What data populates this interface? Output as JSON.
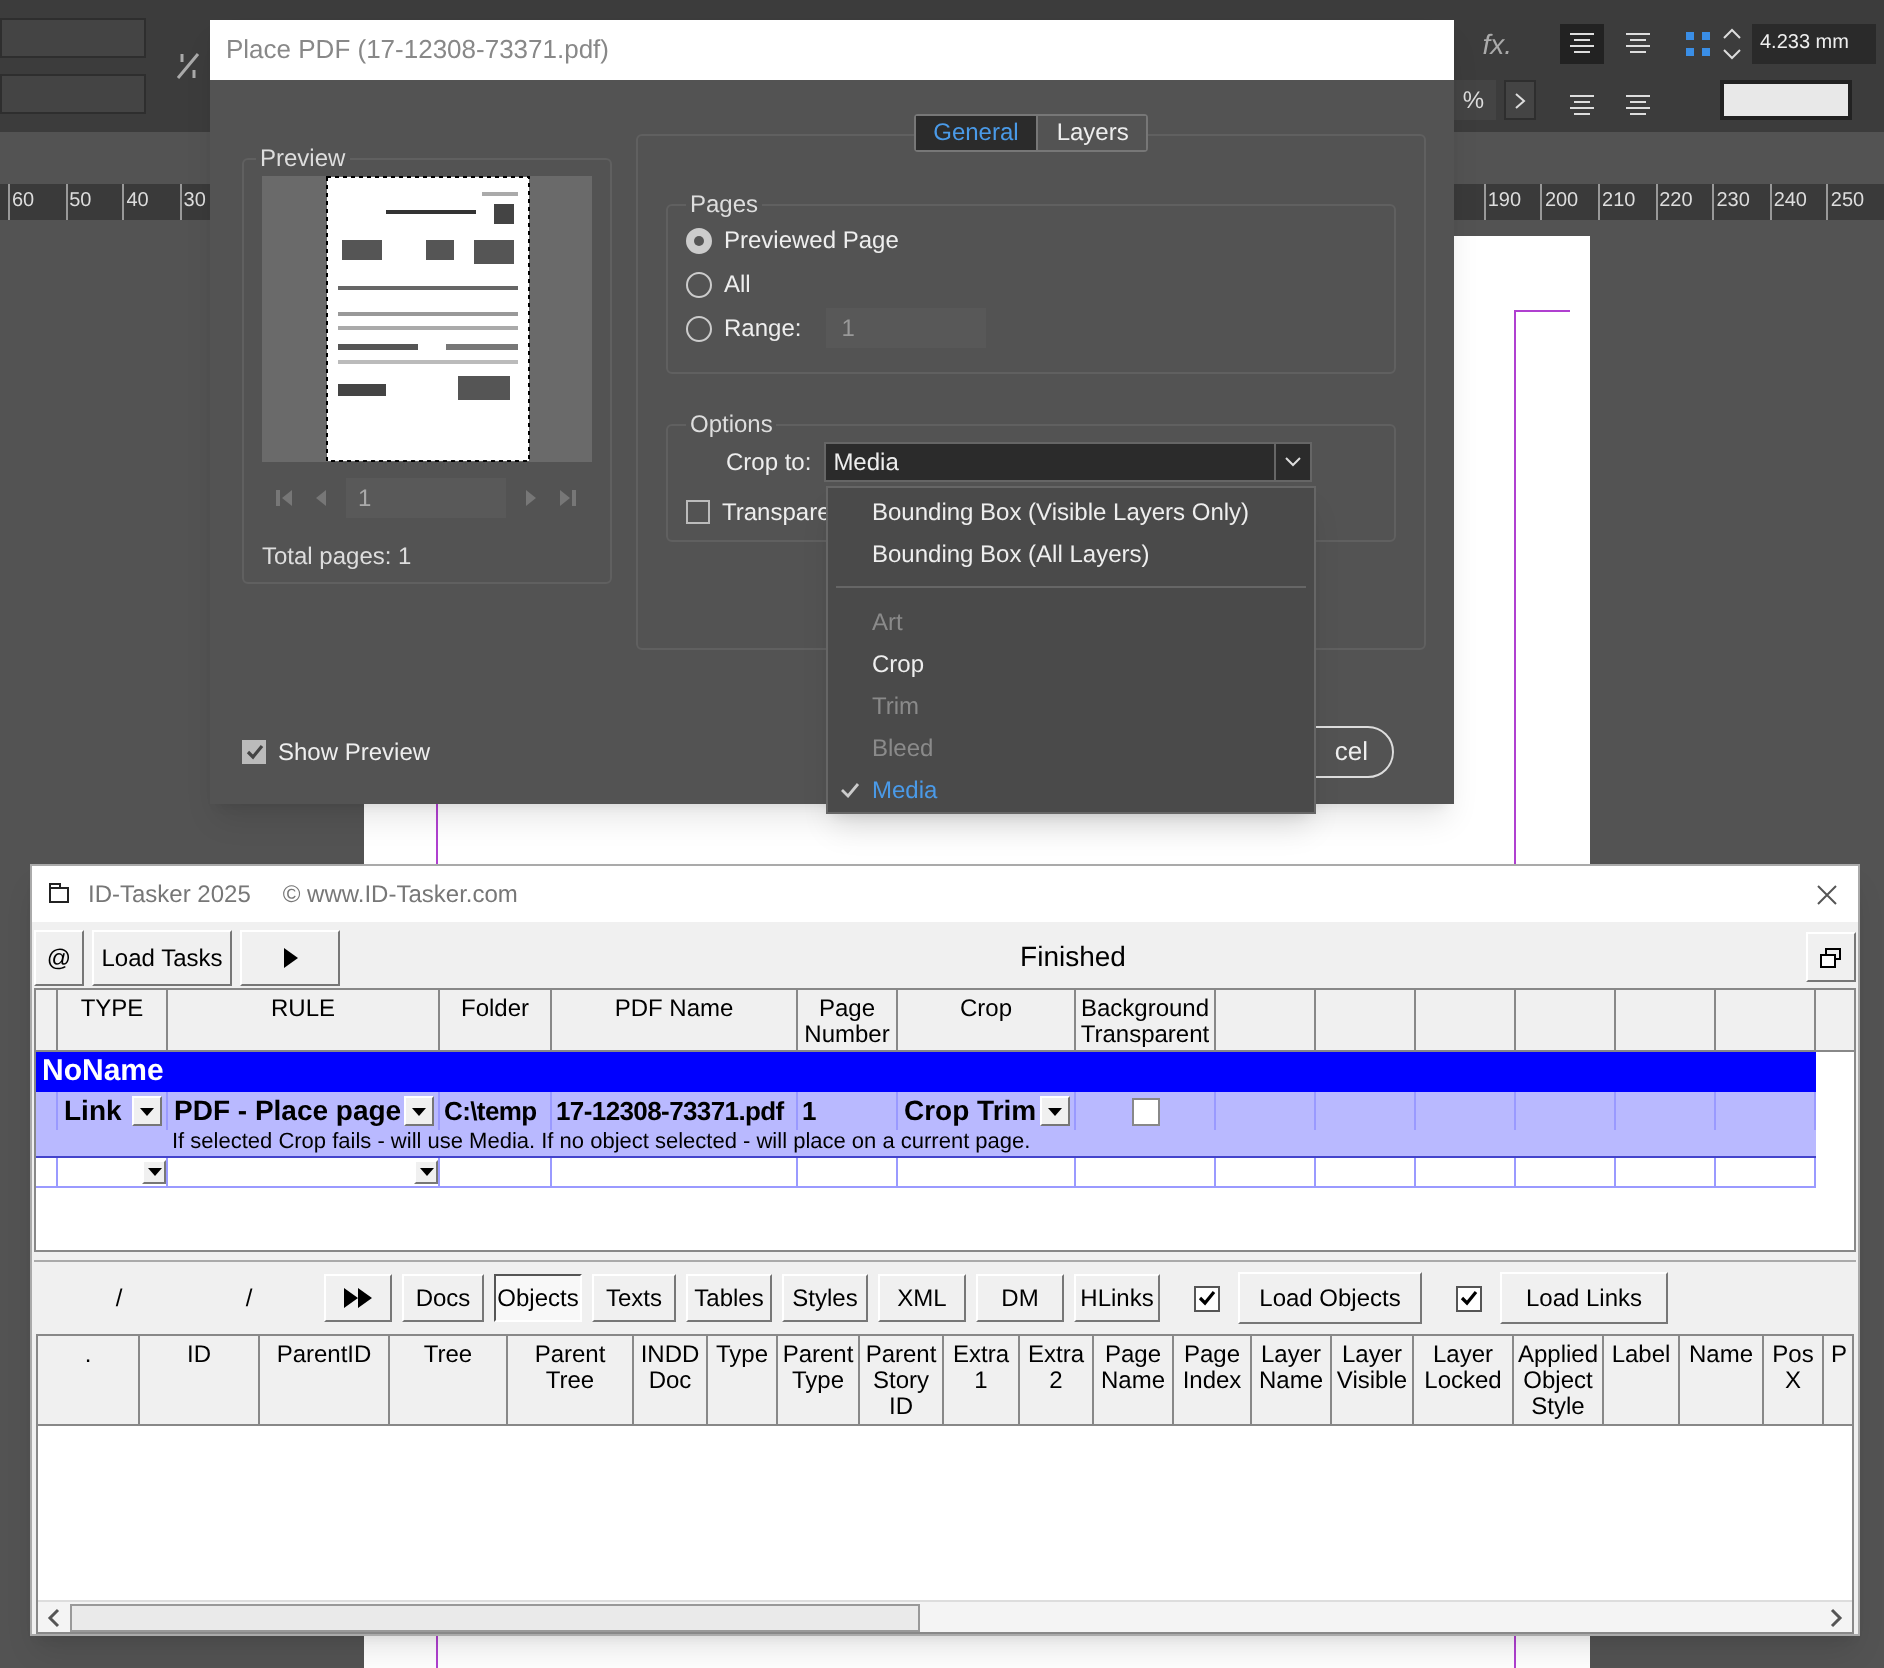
{
  "background_app": {
    "toolbar": {
      "effects_label": "fx.",
      "percent_field": "%",
      "stroke_weight": "4.233 mm"
    },
    "ruler": {
      "left_labels": [
        "60",
        "50",
        "40",
        "30"
      ],
      "right_labels": [
        "190",
        "200",
        "210",
        "220",
        "230",
        "240",
        "250"
      ]
    }
  },
  "place_pdf_dialog": {
    "title": "Place PDF (17-12308-73371.pdf)",
    "tabs": [
      {
        "label": "General",
        "selected": true
      },
      {
        "label": "Layers",
        "selected": false
      }
    ],
    "preview": {
      "heading": "Preview",
      "page_field": "1",
      "total_pages": "Total pages: 1"
    },
    "pages": {
      "heading": "Pages",
      "options": [
        {
          "label": "Previewed Page",
          "selected": true
        },
        {
          "label": "All",
          "selected": false
        },
        {
          "label": "Range:",
          "selected": false
        }
      ],
      "range_field": "1"
    },
    "options": {
      "heading": "Options",
      "crop_label": "Crop to:",
      "crop_value": "Media",
      "transparent_checkbox": {
        "label": "Transpare",
        "checked": false
      }
    },
    "show_preview": {
      "label": "Show Preview",
      "checked": true
    },
    "cancel_button": "cel"
  },
  "crop_menu": {
    "items": [
      {
        "kind": "item",
        "label": "Bounding Box (Visible Layers Only)",
        "disabled": false,
        "selected": false
      },
      {
        "kind": "item",
        "label": "Bounding Box (All Layers)",
        "disabled": false,
        "selected": false
      },
      {
        "kind": "separator"
      },
      {
        "kind": "item",
        "label": "Art",
        "disabled": true,
        "selected": false
      },
      {
        "kind": "item",
        "label": "Crop",
        "disabled": false,
        "selected": false
      },
      {
        "kind": "item",
        "label": "Trim",
        "disabled": true,
        "selected": false
      },
      {
        "kind": "item",
        "label": "Bleed",
        "disabled": true,
        "selected": false
      },
      {
        "kind": "item",
        "label": "Media",
        "disabled": false,
        "selected": true
      }
    ]
  },
  "id_tasker": {
    "title": "ID-Tasker 2025",
    "website": "© www.ID-Tasker.com",
    "toolbar": {
      "at_button": "@",
      "load_tasks_button": "Load Tasks",
      "status": "Finished"
    },
    "task_grid": {
      "columns": [
        "TYPE",
        "RULE",
        "Folder",
        "PDF Name",
        "Page Number",
        "Crop",
        "Background Transparent"
      ],
      "group_row": "NoName",
      "row": {
        "cells": [
          {
            "kind": "dropdown",
            "value": "Link"
          },
          {
            "kind": "dropdown",
            "value": "PDF - Place page"
          },
          {
            "kind": "text",
            "value": "C:\\temp"
          },
          {
            "kind": "text",
            "value": "17-12308-73371.pdf"
          },
          {
            "kind": "text",
            "value": "1"
          },
          {
            "kind": "dropdown",
            "value": "Crop Trim"
          },
          {
            "kind": "checkbox",
            "checked": false
          }
        ],
        "note": "If selected Crop fails - will use Media. If no object selected - will place on a current page."
      }
    },
    "object_panel": {
      "path_labels": [
        "/",
        "/"
      ],
      "tabs": [
        {
          "label": "Docs",
          "selected": false
        },
        {
          "label": "Objects",
          "selected": true
        },
        {
          "label": "Texts",
          "selected": false
        },
        {
          "label": "Tables",
          "selected": false
        },
        {
          "label": "Styles",
          "selected": false
        },
        {
          "label": "XML",
          "selected": false
        },
        {
          "label": "DM",
          "selected": false
        },
        {
          "label": "HLinks",
          "selected": false
        }
      ],
      "load_objects": {
        "label": "Load Objects",
        "checked": true
      },
      "load_links": {
        "label": "Load Links",
        "checked": true
      },
      "columns": [
        ".",
        "ID",
        "ParentID",
        "Tree",
        "Parent Tree",
        "INDD Doc",
        "Type",
        "Parent Type",
        "Parent Story ID",
        "Extra 1",
        "Extra 2",
        "Page Name",
        "Page Index",
        "Layer Name",
        "Layer Visible",
        "Layer Locked",
        "Applied Object Style",
        "Label",
        "Name",
        "Pos X",
        "P"
      ]
    }
  }
}
